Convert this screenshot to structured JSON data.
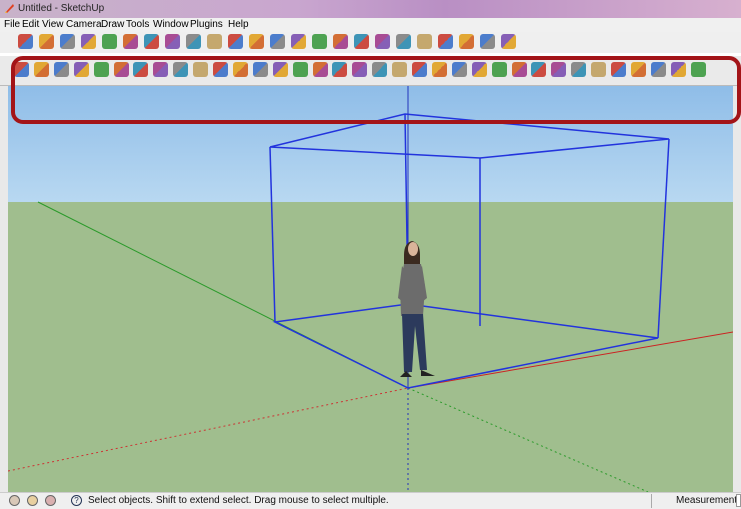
{
  "window": {
    "title": "Untitled - SketchUp"
  },
  "menu": {
    "items": [
      "File",
      "Edit",
      "View",
      "Camera",
      "Draw",
      "Tools",
      "Window",
      "Plugins",
      "Help"
    ]
  },
  "status": {
    "message": "Select objects. Shift to extend select. Drag mouse to select multiple.",
    "measurements_label": "Measurements",
    "help_glyph": "?"
  },
  "colors": {
    "highlight_border": "#a31418",
    "model_edges": "#2233dd",
    "axis_red": "#cc2222",
    "axis_green": "#22aa22",
    "axis_blue": "#2233bb",
    "sky": "#a6cdef",
    "ground": "#a0be8e"
  },
  "toolbar_top_icons": [
    "select-icon",
    "pencil-icon",
    "rectangle-icon",
    "circle-icon",
    "arc-icon",
    "polygon-icon",
    "eraser-icon",
    "tape-measure-icon",
    "paint-bucket-icon",
    "push-pull-icon",
    "move-icon",
    "rotate-icon",
    "follow-me-icon",
    "orbit-icon",
    "pan-icon",
    "zoom-icon",
    "zoom-extents-icon",
    "section-plane-icon",
    "look-around-icon",
    "walk-icon",
    "position-camera-icon",
    "iso-view-icon",
    "top-view-icon",
    "front-view-icon"
  ],
  "toolbar_main_icons": [
    "xray-icon",
    "back-edges-icon",
    "wireframe-icon",
    "hidden-line-icon",
    "shaded-icon",
    "shaded-textures-icon",
    "monochrome-icon",
    "styles-icon",
    "layers-icon",
    "outliner-icon",
    "camera-icon",
    "first-frame-icon",
    "previous-frame-icon",
    "play-icon",
    "next-frame-icon",
    "last-frame-icon",
    "component-icon",
    "3d-warehouse-icon",
    "share-model-icon",
    "get-models-icon",
    "warning-icon",
    "solid-tools-icon",
    "sandbox-icon",
    "dimension-icon",
    "section-fill-icon",
    "grid-icon",
    "text-label-icon",
    "scene-manager-icon",
    "entity-info-icon",
    "soften-edges-icon",
    "swap-icon",
    "wrench-icon",
    "google-earth-icon",
    "geo-location-icon",
    "help-icon"
  ]
}
